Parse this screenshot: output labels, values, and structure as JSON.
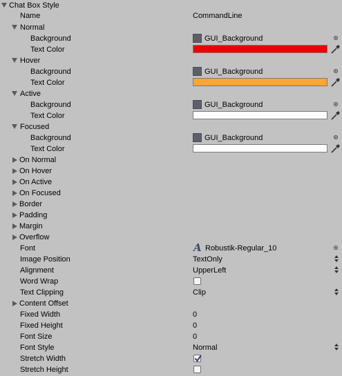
{
  "header": {
    "title": "Chat Box Style"
  },
  "name_row": {
    "label": "Name",
    "value": "CommandLine"
  },
  "states": [
    {
      "label": "Normal",
      "background_label": "Background",
      "background_value": "GUI_Background",
      "text_color_label": "Text Color",
      "text_color": "#ee0000"
    },
    {
      "label": "Hover",
      "background_label": "Background",
      "background_value": "GUI_Background",
      "text_color_label": "Text Color",
      "text_color": "#ffa533"
    },
    {
      "label": "Active",
      "background_label": "Background",
      "background_value": "GUI_Background",
      "text_color_label": "Text Color",
      "text_color": "#ffffff"
    },
    {
      "label": "Focused",
      "background_label": "Background",
      "background_value": "GUI_Background",
      "text_color_label": "Text Color",
      "text_color": "#ffffff"
    }
  ],
  "collapsed": [
    "On Normal",
    "On Hover",
    "On Active",
    "On Focused",
    "Border",
    "Padding",
    "Margin",
    "Overflow"
  ],
  "font": {
    "label": "Font",
    "value": "Robustik-Regular_10"
  },
  "image_position": {
    "label": "Image Position",
    "value": "TextOnly"
  },
  "alignment": {
    "label": "Alignment",
    "value": "UpperLeft"
  },
  "word_wrap": {
    "label": "Word Wrap",
    "checked": false
  },
  "text_clipping": {
    "label": "Text Clipping",
    "value": "Clip"
  },
  "content_offset": {
    "label": "Content Offset"
  },
  "fixed_width": {
    "label": "Fixed Width",
    "value": "0"
  },
  "fixed_height": {
    "label": "Fixed Height",
    "value": "0"
  },
  "font_size": {
    "label": "Font Size",
    "value": "0"
  },
  "font_style": {
    "label": "Font Style",
    "value": "Normal"
  },
  "stretch_width": {
    "label": "Stretch Width",
    "checked": true
  },
  "stretch_height": {
    "label": "Stretch Height",
    "checked": false
  },
  "icons": {
    "fold_open": "triangle-down",
    "fold_closed": "triangle-right",
    "picker": "object-picker",
    "eyedropper": "eyedropper",
    "font_asset": "font-asset",
    "dropdown": "up-down-arrows",
    "check": "checkmark"
  }
}
